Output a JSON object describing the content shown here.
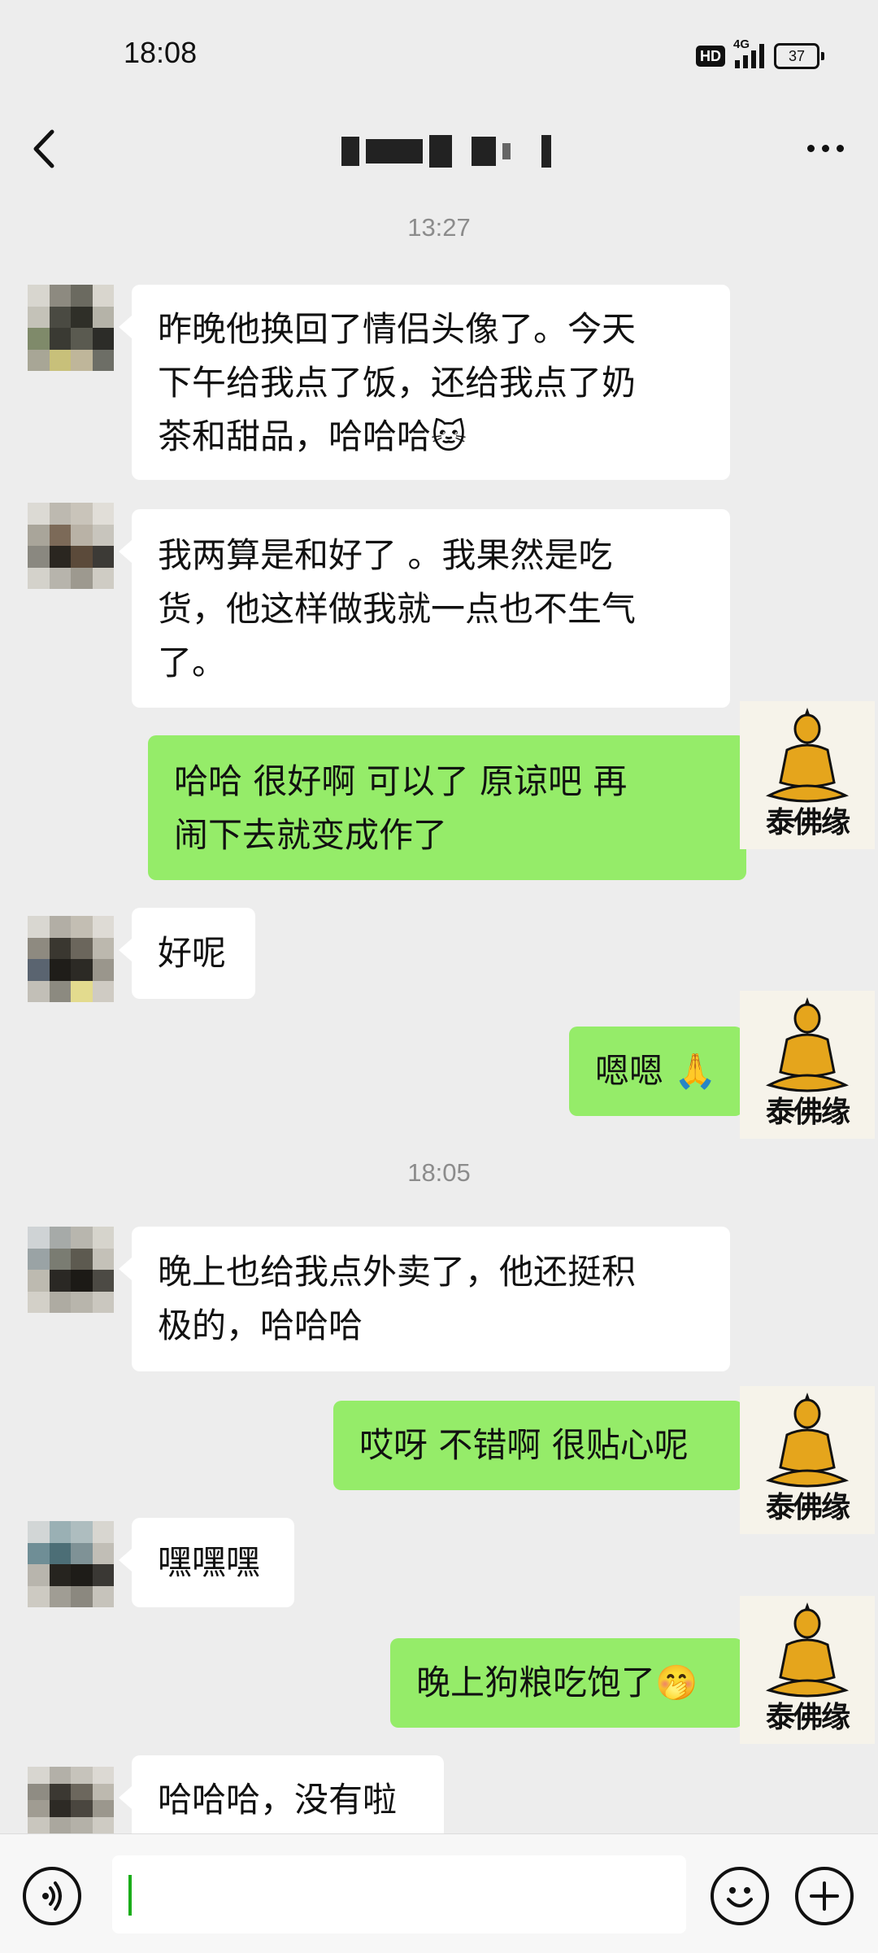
{
  "status_bar": {
    "time": "18:08",
    "hd_badge": "HD",
    "network_label": "4G",
    "battery_level": "37"
  },
  "nav": {
    "back_icon": "chevron-left-icon",
    "more_icon": "more-dots-icon"
  },
  "timestamps": [
    "13:27",
    "18:05"
  ],
  "avatar_caption": "泰佛缘",
  "messages": [
    {
      "direction": "in",
      "lines": [
        "昨晚他换回了情侣头像了。今天",
        "下午给我点了饭，还给我点了奶",
        "茶和甜品，哈哈哈🐱"
      ]
    },
    {
      "direction": "in",
      "lines": [
        "我两算是和好了 。我果然是吃",
        "货，他这样做我就一点也不生气",
        "了。"
      ]
    },
    {
      "direction": "out",
      "lines": [
        "哈哈 很好啊 可以了 原谅吧 再",
        "闹下去就变成作了"
      ]
    },
    {
      "direction": "in",
      "lines": [
        "好呢"
      ]
    },
    {
      "direction": "out",
      "lines": [
        "嗯嗯 🙏"
      ]
    },
    {
      "direction": "in",
      "lines": [
        "晚上也给我点外卖了，他还挺积",
        "极的，哈哈哈"
      ]
    },
    {
      "direction": "out",
      "lines": [
        "哎呀 不错啊 很贴心呢"
      ]
    },
    {
      "direction": "in",
      "lines": [
        "嘿嘿嘿"
      ]
    },
    {
      "direction": "out",
      "lines": [
        "晚上狗粮吃饱了🤭"
      ]
    },
    {
      "direction": "in",
      "lines": [
        "哈哈哈，没有啦"
      ]
    }
  ],
  "input_bar": {
    "voice_icon": "voice-icon",
    "emoji_icon": "emoji-icon",
    "plus_icon": "plus-icon",
    "input_value": ""
  },
  "colors": {
    "background": "#ededed",
    "incoming_bubble": "#ffffff",
    "outgoing_bubble": "#95ec69",
    "timestamp_text": "#8c8c8c",
    "cursor": "#1aad19"
  }
}
